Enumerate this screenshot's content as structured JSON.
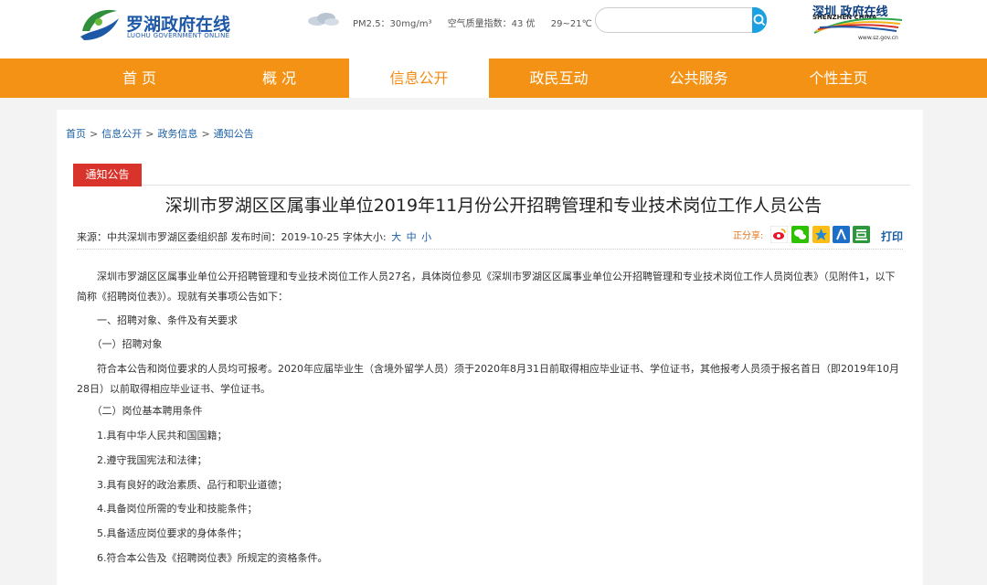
{
  "header": {
    "logo_title": "罗湖政府在线",
    "logo_sub": "LUOHU GOVERNMENT ONLINE",
    "weather_icon": "cloud-icon",
    "pm25": "PM2.5：30mg/m³",
    "aqi": "空气质量指数：43 优",
    "temp": "29~21℃",
    "search_placeholder": "",
    "search_icon": "search-icon",
    "sz_cn": "深圳 政府在线",
    "sz_en": "SHENZHEN CHINA",
    "sz_url": "www.sz.gov.cn"
  },
  "nav": {
    "items": [
      {
        "label": "首 页"
      },
      {
        "label": "概 况"
      },
      {
        "label": "信息公开"
      },
      {
        "label": "政民互动"
      },
      {
        "label": "公共服务"
      },
      {
        "label": "个性主页"
      }
    ]
  },
  "breadcrumb": {
    "items": [
      "首页",
      "信息公开",
      "政务信息",
      "通知公告"
    ],
    "sep": ">"
  },
  "article": {
    "tag": "通知公告",
    "title": "深圳市罗湖区区属事业单位2019年11月份公开招聘管理和专业技术岗位工作人员公告",
    "meta_prefix": "来源：中共深圳市罗湖区委组织部  发布时间：2019-10-25  字体大小:",
    "size_large": "大",
    "size_medium": "中",
    "size_small": "小",
    "share_label": "正分享:",
    "print": "打印",
    "paragraphs": [
      "　　深圳市罗湖区区属事业单位公开招聘管理和专业技术岗位工作人员27名，具体岗位参见《深圳市罗湖区区属事业单位公开招聘管理和专业技术岗位工作人员岗位表》（见附件1，以下简称《招聘岗位表》）。现就有关事项公告如下：",
      "　　一、招聘对象、条件及有关要求",
      "　　（一）招聘对象",
      "　　符合本公告和岗位要求的人员均可报考。2020年应届毕业生（含境外留学人员）须于2020年8月31日前取得相应毕业证书、学位证书，其他报考人员须于报名首日（即2019年10月28日）以前取得相应毕业证书、学位证书。",
      "　　（二）岗位基本聘用条件",
      "　　1.具有中华人民共和国国籍；",
      "　　2.遵守我国宪法和法律；",
      "　　3.具有良好的政治素质、品行和职业道德；",
      "　　4.具备岗位所需的专业和技能条件；",
      "　　5.具备适应岗位要求的身体条件；",
      "　　6.符合本公告及《招聘岗位表》所规定的资格条件。"
    ]
  },
  "colors": {
    "nav_bg": "#f39214",
    "nav_active_text": "#f28b13",
    "tag_bg": "#d9342b",
    "link": "#1a5fa6",
    "search_btn": "#1ba1e2"
  }
}
